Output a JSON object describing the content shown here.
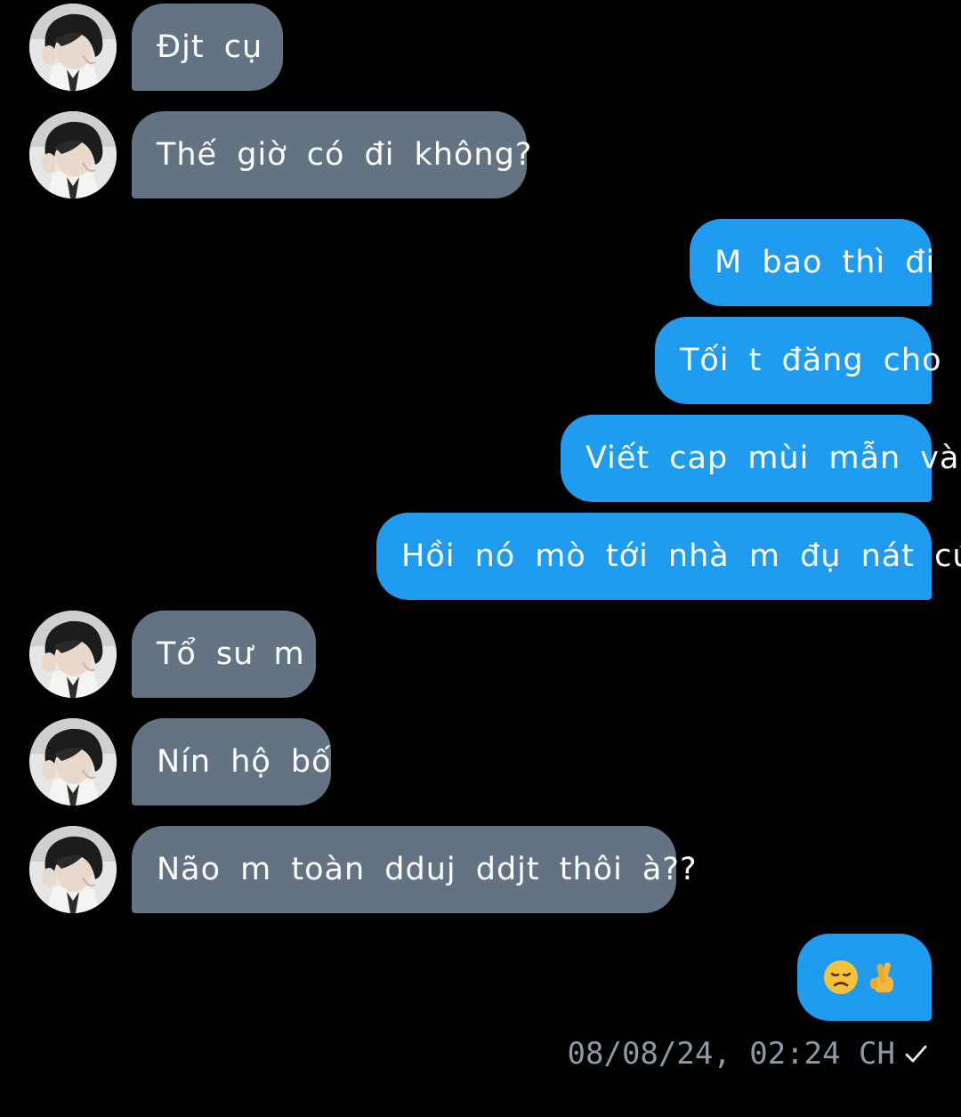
{
  "messages": [
    {
      "direction": "incoming",
      "text": "Đjt cụ"
    },
    {
      "direction": "incoming",
      "text": "Thế giờ có đi không?"
    },
    {
      "direction": "outgoing",
      "text": "M bao thì đi"
    },
    {
      "direction": "outgoing",
      "text": "Tối t đăng cho"
    },
    {
      "direction": "outgoing",
      "text": "Viết cap mùi mẫn vào"
    },
    {
      "direction": "outgoing",
      "text": "Hồi nó mò tới nhà m đụ nát cúc"
    },
    {
      "direction": "incoming",
      "text": "Tổ sư m"
    },
    {
      "direction": "incoming",
      "text": "Nín hộ bố"
    },
    {
      "direction": "incoming",
      "text": "Não m toàn dduj ddjt thôi à??"
    },
    {
      "direction": "outgoing",
      "emojis": [
        "disappointed-face-emoji",
        "crossed-fingers-emoji"
      ]
    }
  ],
  "timestamp": "08/08/24, 02:24 CH",
  "status_icon": "check-icon",
  "colors": {
    "background": "#000000",
    "incoming_bubble": "#637384",
    "outgoing_bubble": "#1f9bf0",
    "text": "#ffffff",
    "timestamp": "#8e99a4"
  }
}
